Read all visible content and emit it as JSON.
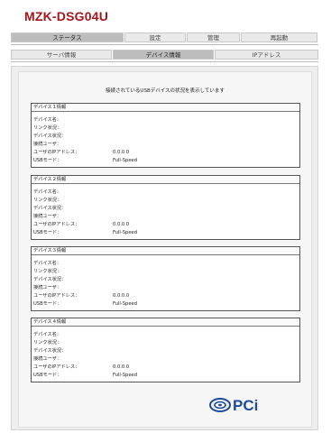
{
  "app_title": "MZK-DSG04U",
  "main_tabs": [
    {
      "label": "ステータス",
      "active": true
    },
    {
      "label": "設定",
      "active": false
    },
    {
      "label": "管理",
      "active": false
    },
    {
      "label": "再起動",
      "active": false
    }
  ],
  "sub_tabs": [
    {
      "label": "サーバ情報",
      "active": false
    },
    {
      "label": "デバイス情報",
      "active": true
    },
    {
      "label": "IPアドレス",
      "active": false
    }
  ],
  "message": "接続されているUSBデバイスの状況を表示しています",
  "field_labels": {
    "device_name": "デバイス名：",
    "link_status": "リンク状況：",
    "device_status": "デバイス状況：",
    "connected_user": "接続ユーザ：",
    "user_ip": "ユーザのIPアドレス：",
    "usb_mode": "USBモード："
  },
  "devices": [
    {
      "header": "デバイス１情報",
      "device_name": "",
      "link_status": "",
      "device_status": "",
      "connected_user": "",
      "user_ip": "0.0.0.0",
      "usb_mode": "Full-Speed"
    },
    {
      "header": "デバイス２情報",
      "device_name": "",
      "link_status": "",
      "device_status": "",
      "connected_user": "",
      "user_ip": "0.0.0.0",
      "usb_mode": "Full-Speed"
    },
    {
      "header": "デバイス３情報",
      "device_name": "",
      "link_status": "",
      "device_status": "",
      "connected_user": "",
      "user_ip": "0.0.0.0",
      "usb_mode": "Full-Speed"
    },
    {
      "header": "デバイス４情報",
      "device_name": "",
      "link_status": "",
      "device_status": "",
      "connected_user": "",
      "user_ip": "0.0.0.0",
      "usb_mode": "Full-Speed"
    }
  ],
  "logo": {
    "icon": "pci-logo-icon",
    "text": "PCi",
    "color": "#1e4aa0"
  }
}
